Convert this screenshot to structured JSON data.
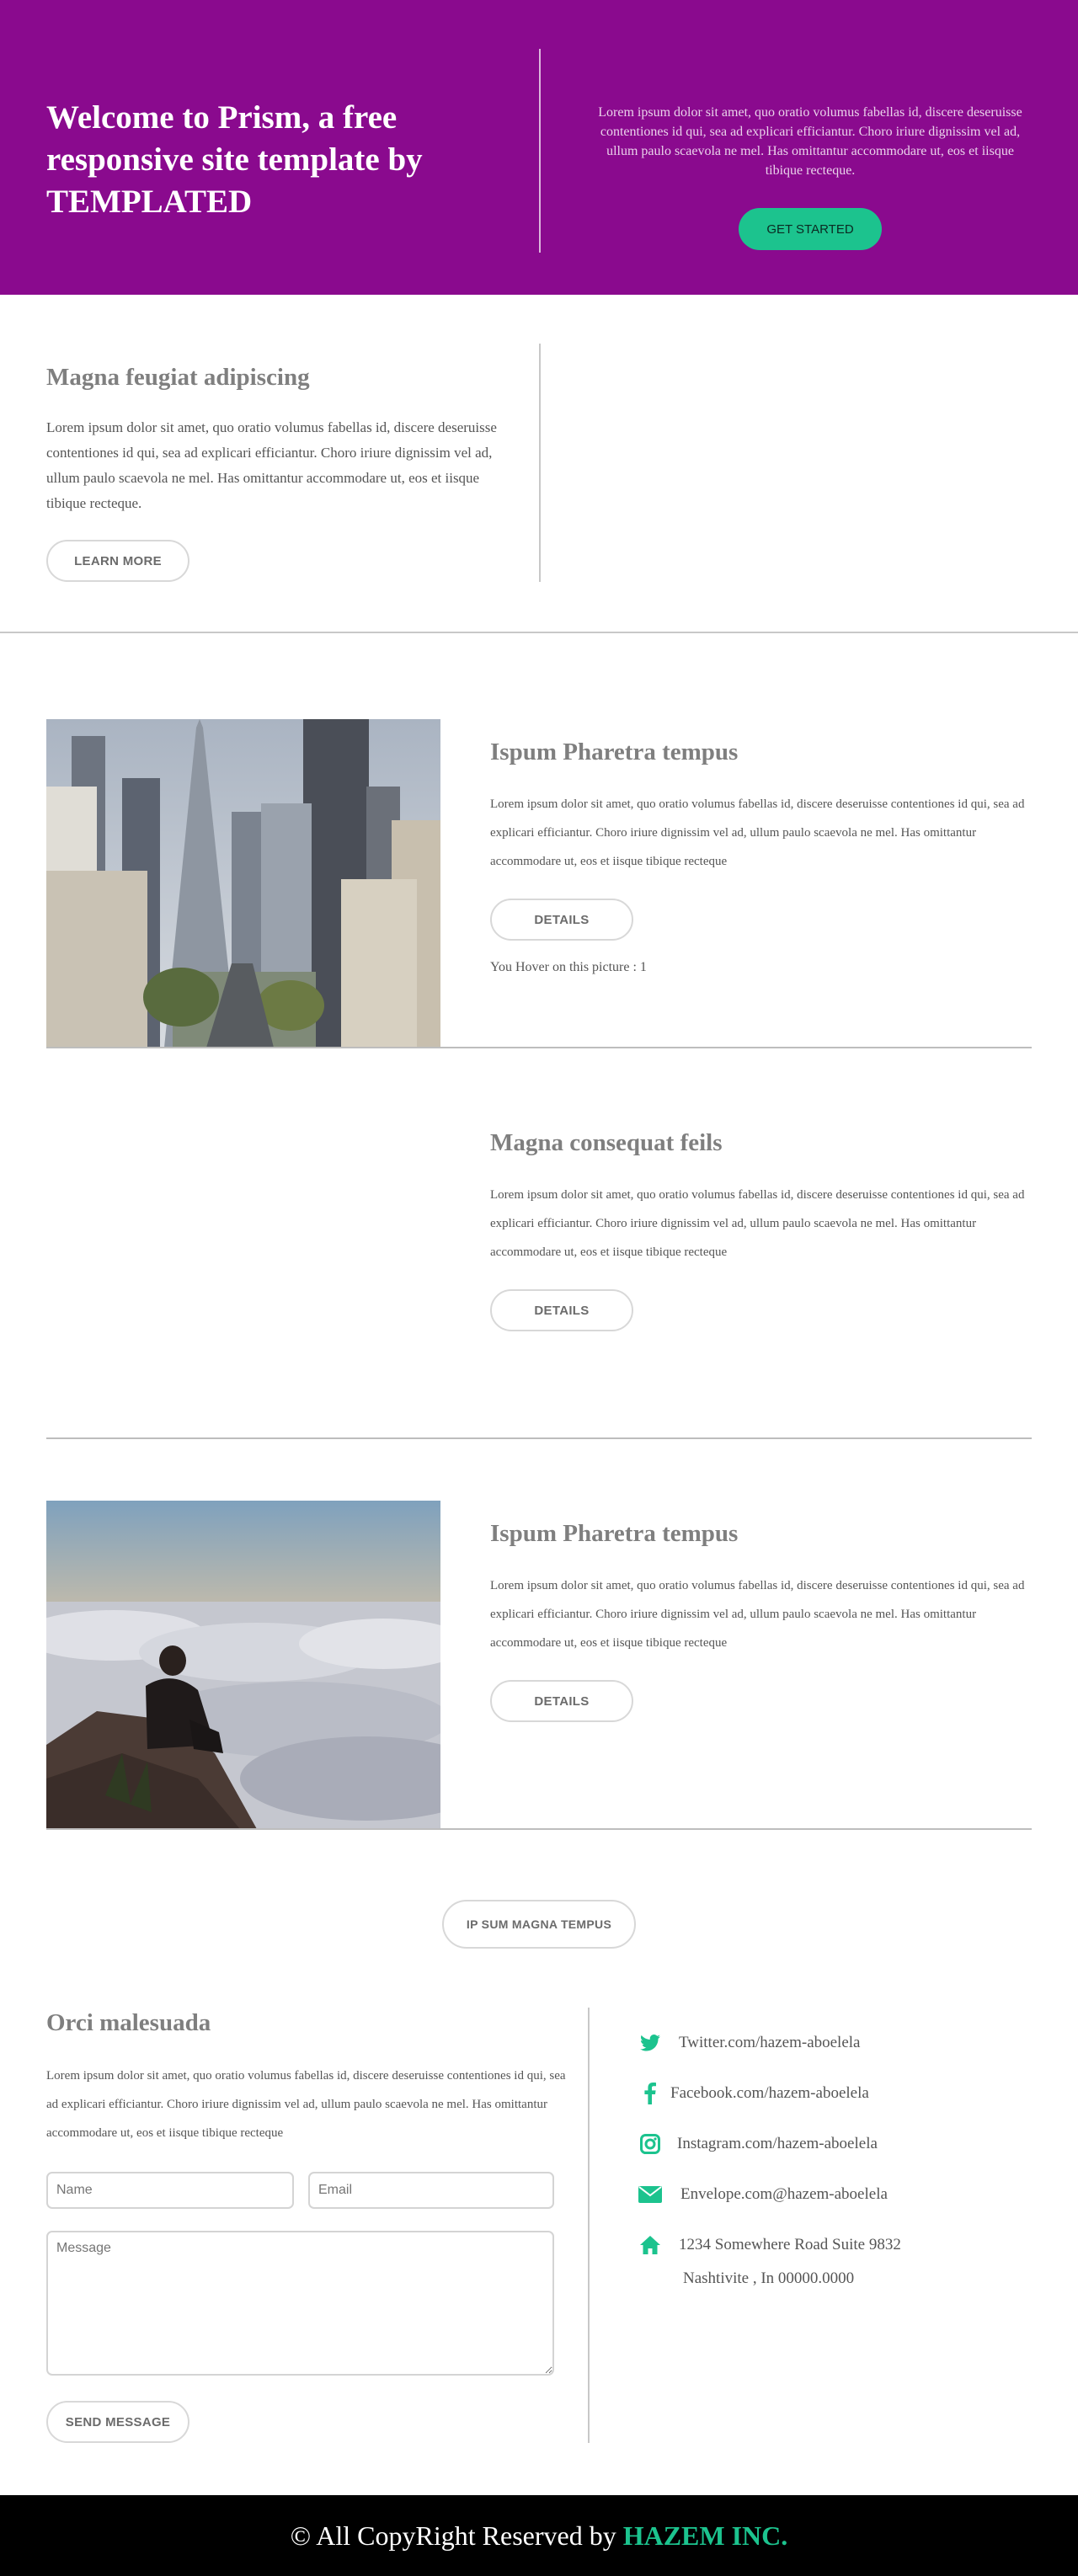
{
  "banner": {
    "title": "Welcome to Prism, a free responsive site template by TEMPLATED",
    "text": "Lorem ipsum dolor sit amet, quo oratio volumus fabellas id, discere deseruisse contentiones id qui, sea ad explicari efficiantur. Choro iriure dignissim vel ad, ullum paulo scaevola ne mel. Has omittantur accommodare ut, eos et iisque tibique recteque.",
    "cta_label": "GET STARTED"
  },
  "intro": {
    "heading": "Magna feugiat adipiscing",
    "text": "Lorem ipsum dolor sit amet, quo oratio volumus fabellas id, discere deseruisse contentiones id qui, sea ad explicari efficiantur. Choro iriure dignissim vel ad, ullum paulo scaevola ne mel. Has omittantur accommodare ut, eos et iisque tibique recteque.",
    "button_label": "LEARN MORE"
  },
  "features": [
    {
      "heading": "Ispum Pharetra tempus",
      "text": "Lorem ipsum dolor sit amet, quo oratio volumus fabellas id, discere deseruisse contentiones id qui, sea ad explicari efficiantur. Choro iriure dignissim vel ad, ullum paulo scaevola ne mel. Has omittantur accommodare ut, eos et iisque tibique recteque",
      "button_label": "DETAILS",
      "hover_text": "You Hover on this picture : 1"
    },
    {
      "heading": "Magna consequat feils",
      "text": "Lorem ipsum dolor sit amet, quo oratio volumus fabellas id, discere deseruisse contentiones id qui, sea ad explicari efficiantur. Choro iriure dignissim vel ad, ullum paulo scaevola ne mel. Has omittantur accommodare ut, eos et iisque tibique recteque",
      "button_label": "DETAILS"
    },
    {
      "heading": "Ispum Pharetra tempus",
      "text": "Lorem ipsum dolor sit amet, quo oratio volumus fabellas id, discere deseruisse contentiones id qui, sea ad explicari efficiantur. Choro iriure dignissim vel ad, ullum paulo scaevola ne mel. Has omittantur accommodare ut, eos et iisque tibique recteque",
      "button_label": "DETAILS"
    }
  ],
  "center_button_label": "IP SUM MAGNA TEMPUS",
  "contact": {
    "heading": "Orci malesuada",
    "text": "Lorem ipsum dolor sit amet, quo oratio volumus fabellas id, discere deseruisse contentiones id qui, sea ad explicari efficiantur. Choro iriure dignissim vel ad, ullum paulo scaevola ne mel. Has omittantur accommodare ut, eos et iisque tibique recteque",
    "name_placeholder": "Name",
    "email_placeholder": "Email",
    "message_placeholder": "Message",
    "submit_label": "SEND MESSAGE"
  },
  "social": {
    "twitter": "Twitter.com/hazem-aboelela",
    "facebook": "Facebook.com/hazem-aboelela",
    "instagram": "Instagram.com/hazem-aboelela",
    "email": "Envelope.com@hazem-aboelela",
    "address_line1": "1234 Somewhere Road Suite 9832",
    "address_line2": "Nashtivite , In 00000.0000",
    "icons": [
      "twitter-icon",
      "facebook-icon",
      "instagram-icon",
      "envelope-icon",
      "home-icon"
    ],
    "icon_color": "#1cc38e"
  },
  "footer": {
    "text": "© All CopyRight Reserved by",
    "brand": "HAZEM INC."
  },
  "colors": {
    "banner_bg": "#8a0a8e",
    "accent": "#1cc38e",
    "footer_bg": "#000000"
  }
}
